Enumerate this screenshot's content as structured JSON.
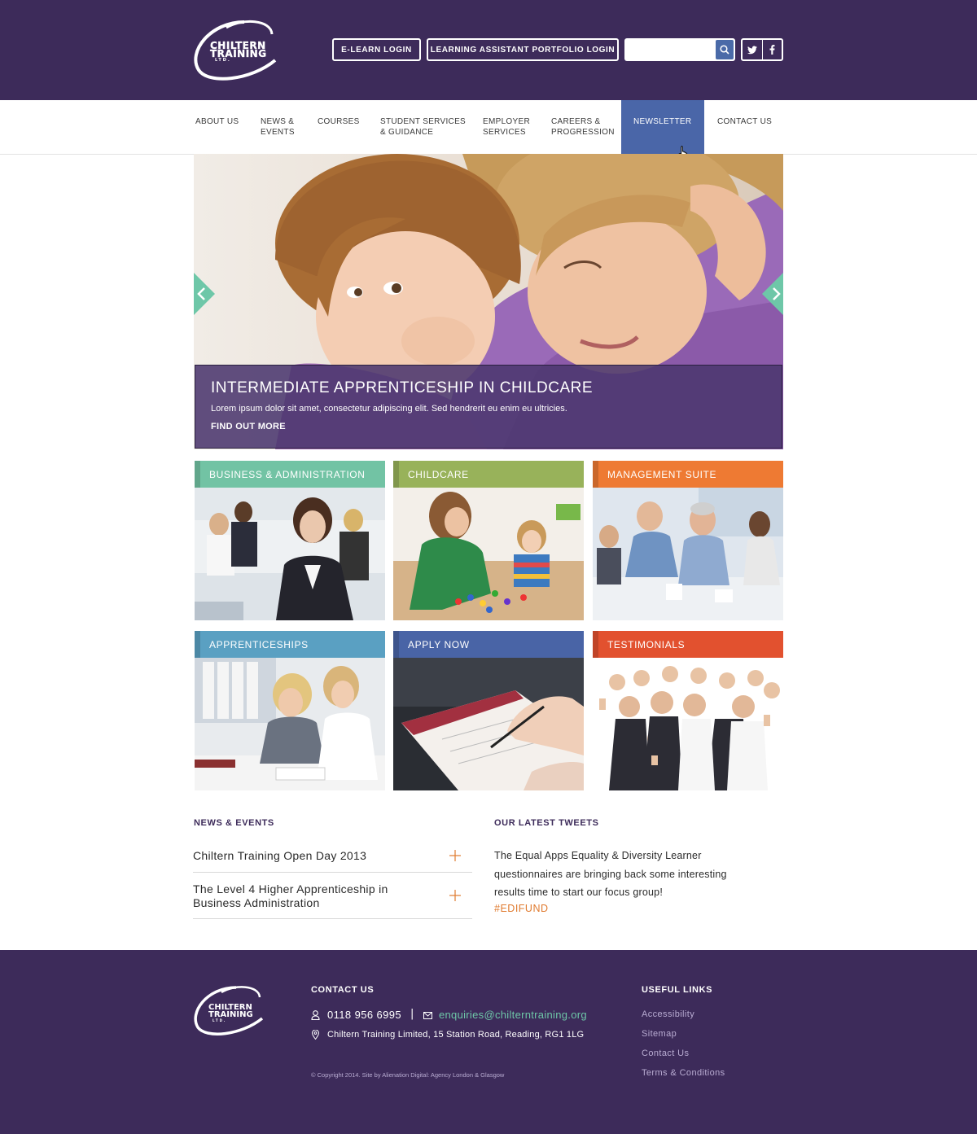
{
  "header": {
    "logo": {
      "line1": "CHILTERN",
      "line2": "TRAINING",
      "line3": "LTD."
    },
    "elearn_label": "E-LEARN LOGIN",
    "lap_label": "LEARNING ASSISTANT PORTFOLIO LOGIN",
    "search": {
      "placeholder": "",
      "value": ""
    },
    "social": {
      "twitter": "twitter-icon",
      "facebook": "facebook-icon"
    }
  },
  "nav": {
    "items": [
      {
        "label": "ABOUT US"
      },
      {
        "label": "NEWS &\nEVENTS"
      },
      {
        "label": "COURSES"
      },
      {
        "label": "STUDENT SERVICES\n& GUIDANCE"
      },
      {
        "label": "EMPLOYER\nSERVICES"
      },
      {
        "label": "CAREERS &\nPROGRESSION"
      },
      {
        "label": "NEWSLETTER",
        "active": true
      },
      {
        "label": "CONTACT US"
      }
    ]
  },
  "hero": {
    "title": "INTERMEDIATE APPRENTICESHIP IN CHILDCARE",
    "text": "Lorem ipsum dolor sit amet, consectetur adipiscing elit. Sed hendrerit eu enim eu ultricies.",
    "link": "FIND OUT MORE"
  },
  "tiles": [
    {
      "label": "BUSINESS & ADMINISTRATION",
      "color": "#72c3a4"
    },
    {
      "label": "CHILDCARE",
      "color": "#98b25a"
    },
    {
      "label": "MANAGEMENT SUITE",
      "color": "#ee7a33"
    },
    {
      "label": "APPRENTICESHIPS",
      "color": "#5aa0c2"
    },
    {
      "label": "APPLY NOW",
      "color": "#4964a6"
    },
    {
      "label": "TESTIMONIALS",
      "color": "#e2512f"
    }
  ],
  "news": {
    "title": "NEWS & EVENTS",
    "items": [
      {
        "text": "Chiltern Training Open Day 2013"
      },
      {
        "text": "The Level 4 Higher Apprenticeship in Business Administration"
      }
    ]
  },
  "tweets": {
    "title": "OUR LATEST TWEETS",
    "text": "The Equal Apps Equality & Diversity Learner questionnaires are bringing back some interesting results time to start our focus group!",
    "hashtag": "#EDIFUND"
  },
  "footer": {
    "contact_title": "CONTACT US",
    "phone": "0118 956 6995",
    "separator": "|",
    "email": "enquiries@chilterntraining.org",
    "address": "Chiltern Training Limited, 15 Station Road, Reading, RG1 1LG",
    "copyright": "© Copyright 2014. Site by Alienation Digital: Agency London & Glasgow",
    "links_title": "USEFUL LINKS",
    "links": [
      {
        "label": "Accessibility"
      },
      {
        "label": "Sitemap"
      },
      {
        "label": "Contact Us"
      },
      {
        "label": "Terms & Conditions"
      }
    ]
  },
  "colors": {
    "brand_purple": "#3d2b5a",
    "nav_active": "#4a66a8",
    "accent_teal": "#6ec7a8",
    "accent_orange": "#e07a2e"
  }
}
